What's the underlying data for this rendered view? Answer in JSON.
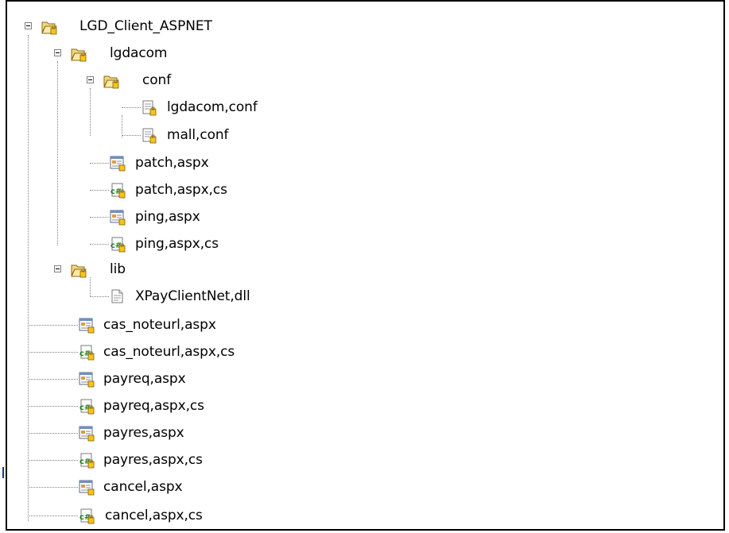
{
  "tree": {
    "root": {
      "label": "LGD_Client_ASPNET",
      "icon": "folder-open-icon",
      "expanded": true
    },
    "lgdacom": {
      "label": "lgdacom",
      "icon": "folder-open-icon",
      "expanded": true
    },
    "conf": {
      "label": "conf",
      "icon": "folder-open-icon",
      "expanded": true
    },
    "lgdacom_conf": {
      "label": "lgdacom,conf",
      "icon": "config-file-icon"
    },
    "mall_conf": {
      "label": "mall,conf",
      "icon": "config-file-icon"
    },
    "patch_aspx": {
      "label": "patch,aspx",
      "icon": "aspx-page-icon"
    },
    "patch_aspx_cs": {
      "label": "patch,aspx,cs",
      "icon": "csharp-file-icon"
    },
    "ping_aspx": {
      "label": "ping,aspx",
      "icon": "aspx-page-icon"
    },
    "ping_aspx_cs": {
      "label": "ping,aspx,cs",
      "icon": "csharp-file-icon"
    },
    "lib": {
      "label": "lib",
      "icon": "folder-open-icon",
      "expanded": true
    },
    "xpay_dll": {
      "label": "XPayClientNet,dll",
      "icon": "dll-file-icon"
    },
    "cas_noteurl_aspx": {
      "label": "cas_noteurl,aspx",
      "icon": "aspx-page-icon"
    },
    "cas_noteurl_aspx_cs": {
      "label": "cas_noteurl,aspx,cs",
      "icon": "csharp-file-icon"
    },
    "payreq_aspx": {
      "label": "payreq,aspx",
      "icon": "aspx-page-icon"
    },
    "payreq_aspx_cs": {
      "label": "payreq,aspx,cs",
      "icon": "csharp-file-icon"
    },
    "payres_aspx": {
      "label": "payres,aspx",
      "icon": "aspx-page-icon"
    },
    "payres_aspx_cs": {
      "label": "payres,aspx,cs",
      "icon": "csharp-file-icon"
    },
    "cancel_aspx": {
      "label": "cancel,aspx",
      "icon": "aspx-page-icon"
    },
    "cancel_aspx_cs": {
      "label": "cancel,aspx,cs",
      "icon": "csharp-file-icon"
    }
  }
}
